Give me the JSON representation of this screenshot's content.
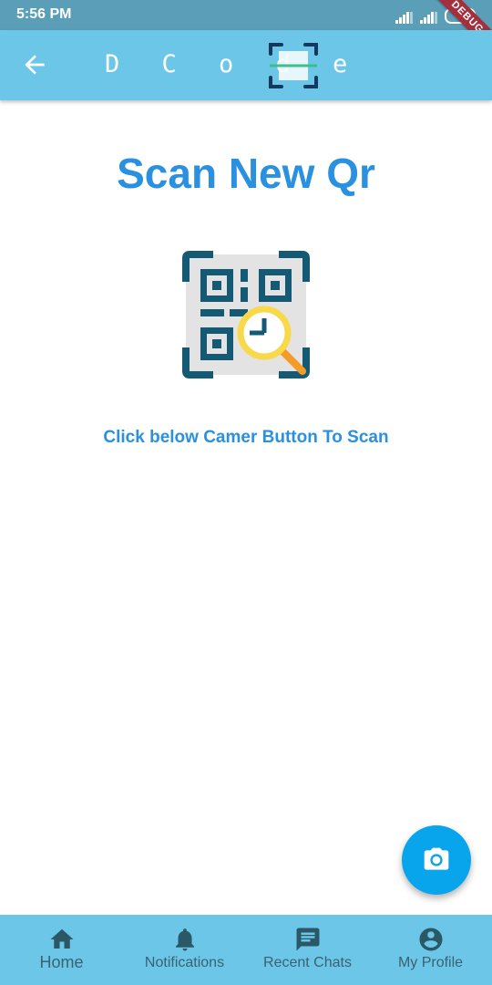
{
  "status_bar": {
    "time": "5:56 PM",
    "battery": "80"
  },
  "debug_ribbon": "DEBUG",
  "app_bar": {
    "title": "D C o d e",
    "back_icon": "arrow-back-icon",
    "logo_icon": "qr-scan-logo-icon"
  },
  "main": {
    "title": "Scan New Qr",
    "illustration_icon": "qr-code-search-icon",
    "instruction": "Click below Camer Button To Scan"
  },
  "fab": {
    "icon": "camera-icon",
    "color": "#08a4ec"
  },
  "bottom_nav": {
    "items": [
      {
        "label": "Home",
        "icon": "home-icon"
      },
      {
        "label": "Notifications",
        "icon": "bell-icon"
      },
      {
        "label": "Recent Chats",
        "icon": "chat-icon"
      },
      {
        "label": "My Profile",
        "icon": "account-circle-icon"
      }
    ],
    "active_index": 0
  },
  "colors": {
    "status_bar": "#5a9eb8",
    "app_bar": "#6cc6e8",
    "title_text": "#2a90e0",
    "nav_icon": "#2b5866"
  }
}
